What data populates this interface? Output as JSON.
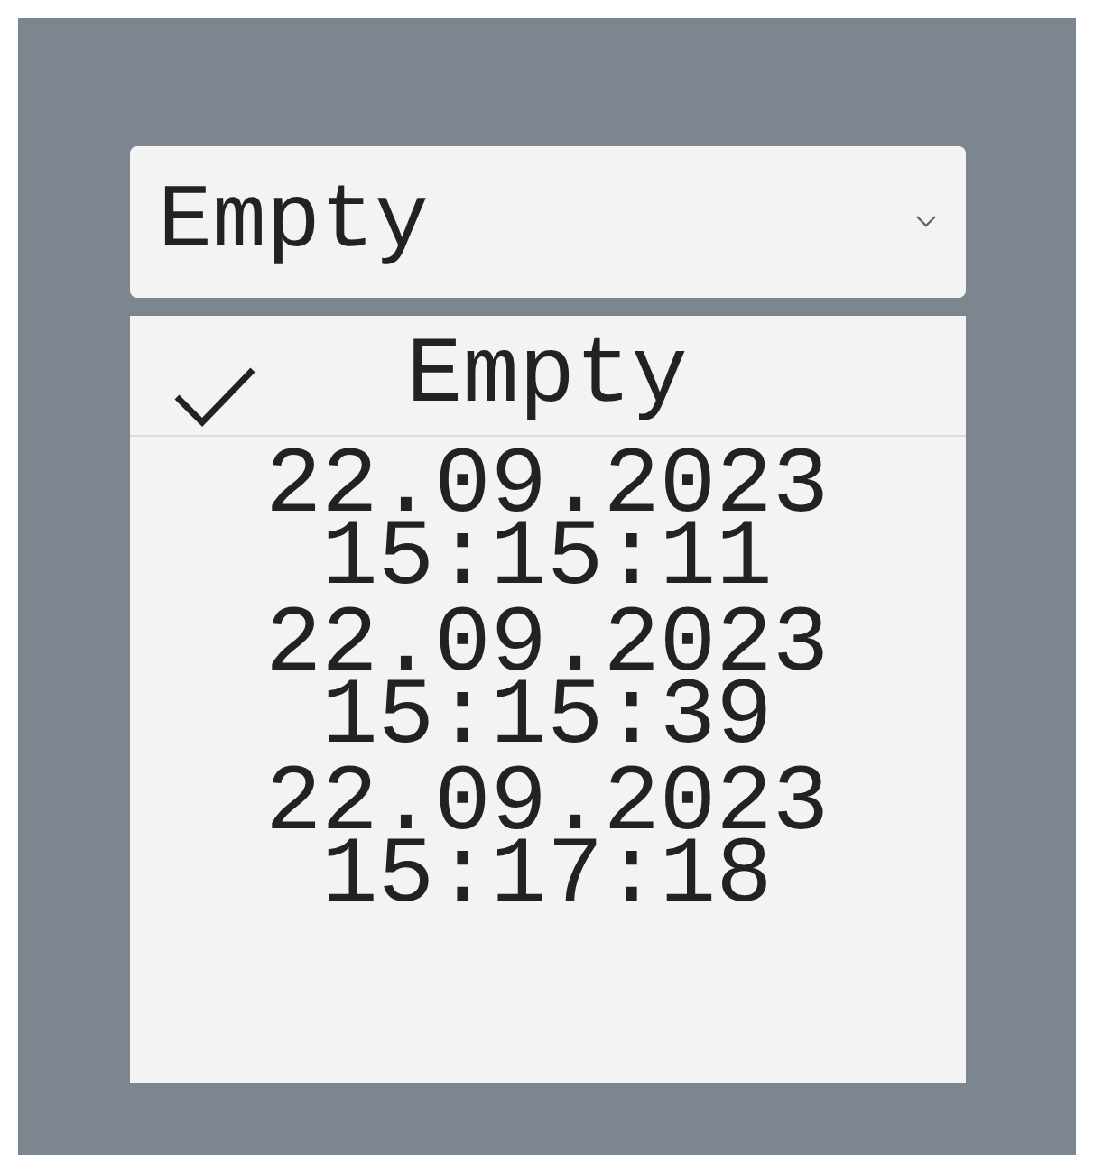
{
  "select": {
    "value": "Empty"
  },
  "options": [
    {
      "lines": [
        "Empty"
      ],
      "selected": true
    },
    {
      "lines": [
        "22.09.2023",
        "15:15:11"
      ],
      "selected": false
    },
    {
      "lines": [
        "22.09.2023",
        "15:15:39"
      ],
      "selected": false
    },
    {
      "lines": [
        "22.09.2023",
        "15:17:18"
      ],
      "selected": false
    }
  ]
}
